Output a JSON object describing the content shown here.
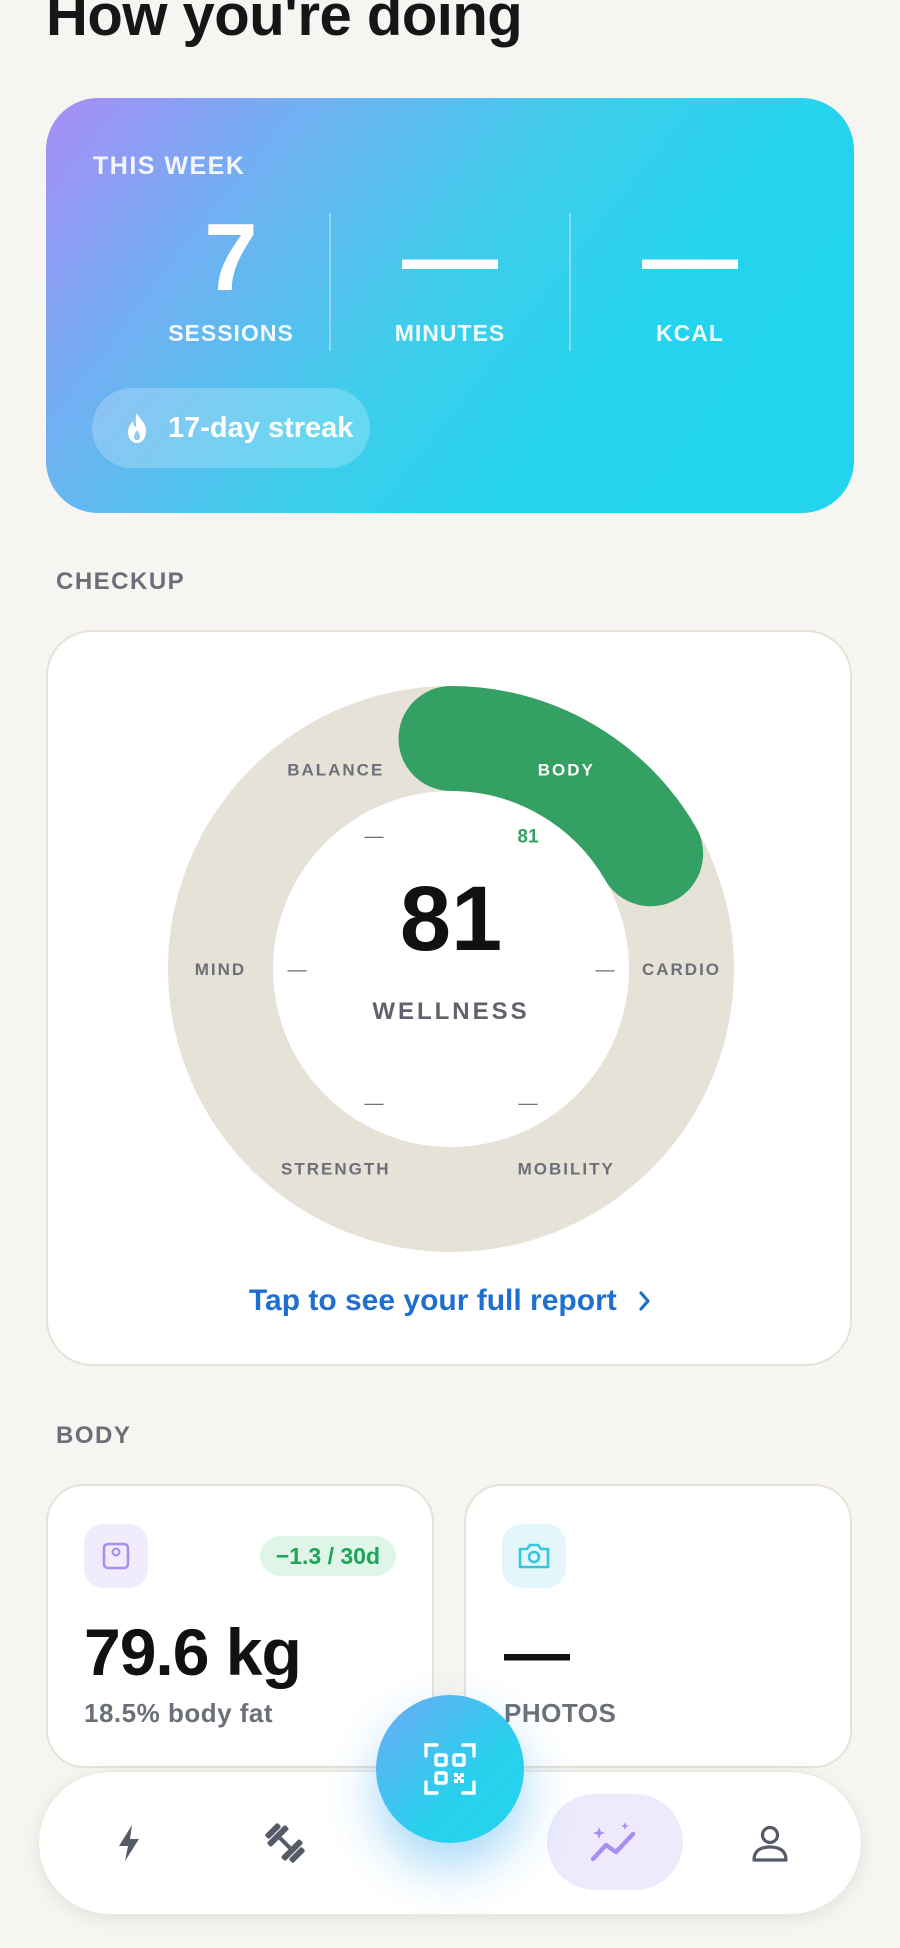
{
  "header": {
    "title": "How you're doing"
  },
  "week": {
    "label": "THIS WEEK",
    "stats": [
      {
        "value": "7",
        "label": "SESSIONS"
      },
      {
        "value": "—",
        "label": "MINUTES"
      },
      {
        "value": "—",
        "label": "KCAL"
      }
    ],
    "streak": {
      "icon": "flame-icon",
      "text": "17-day streak"
    }
  },
  "checkup": {
    "section_title": "CHECKUP",
    "score": "81",
    "score_label": "WELLNESS",
    "segments": [
      {
        "name": "BODY",
        "value": "81",
        "score": 81
      },
      {
        "name": "CARDIO",
        "value": "—"
      },
      {
        "name": "MOBILITY",
        "value": "—"
      },
      {
        "name": "STRENGTH",
        "value": "—"
      },
      {
        "name": "MIND",
        "value": "—"
      },
      {
        "name": "BALANCE",
        "value": "—"
      }
    ],
    "link": "Tap to see your full report",
    "colors": {
      "track": "#e6e2d7",
      "active": "#34a064"
    }
  },
  "body": {
    "section_title": "BODY",
    "weight": {
      "icon": "scale-icon",
      "value": "79.6 kg",
      "sub": "18.5% body fat",
      "delta": "−1.3 / 30d"
    },
    "photos": {
      "icon": "camera-icon",
      "value": "—",
      "label": "PHOTOS"
    }
  },
  "nav": {
    "items": [
      {
        "icon": "bolt-icon"
      },
      {
        "icon": "dumbbell-icon"
      },
      {
        "icon": "qr-scan-icon"
      },
      {
        "icon": "progress-chart-icon",
        "active": true
      },
      {
        "icon": "profile-icon"
      }
    ]
  }
}
